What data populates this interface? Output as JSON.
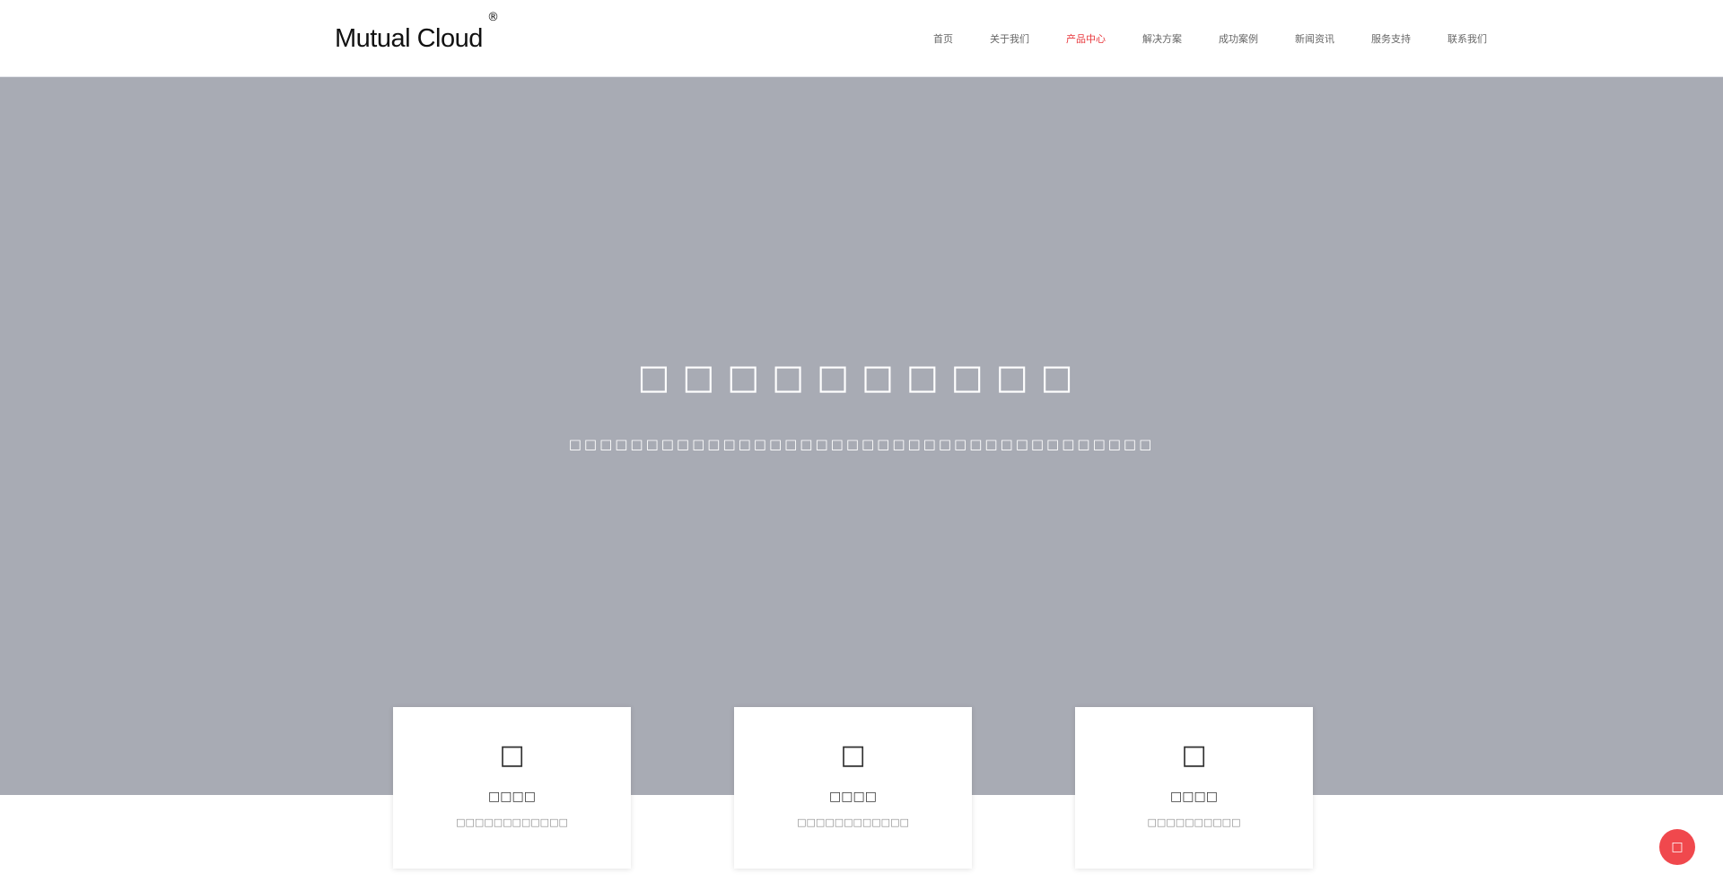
{
  "header": {
    "logo_text": "Mutual Cloud",
    "logo_mark": "®",
    "nav": [
      {
        "label": "首页",
        "active": false
      },
      {
        "label": "关于我们",
        "active": false
      },
      {
        "label": "产品中心",
        "active": true
      },
      {
        "label": "解决方案",
        "active": false
      },
      {
        "label": "成功案例",
        "active": false
      },
      {
        "label": "新闻资讯",
        "active": false
      },
      {
        "label": "服务支持",
        "active": false
      },
      {
        "label": "联系我们",
        "active": false
      }
    ]
  },
  "hero": {
    "title": "□□□□□□□□□□",
    "subtitle": "□□□□□□□□□□□□□□□□□□□□□□□□□□□□□□□□□□□□□□"
  },
  "cards": [
    {
      "icon": "square-placeholder-icon",
      "glyph": "□",
      "title": "□□□□",
      "desc": "□□□□□□□□□□□□"
    },
    {
      "icon": "square-placeholder-icon",
      "glyph": "□",
      "title": "□□□□",
      "desc": "□□□□□□□□□□□□"
    },
    {
      "icon": "square-placeholder-icon",
      "glyph": "□",
      "title": "□□□□",
      "desc": "□□□□□□□□□□"
    }
  ],
  "back_to_top": {
    "glyph": "□"
  },
  "colors": {
    "accent": "#e8383d",
    "hero_bg": "#a8abb4",
    "back_to_top_bg": "#f0484d"
  }
}
